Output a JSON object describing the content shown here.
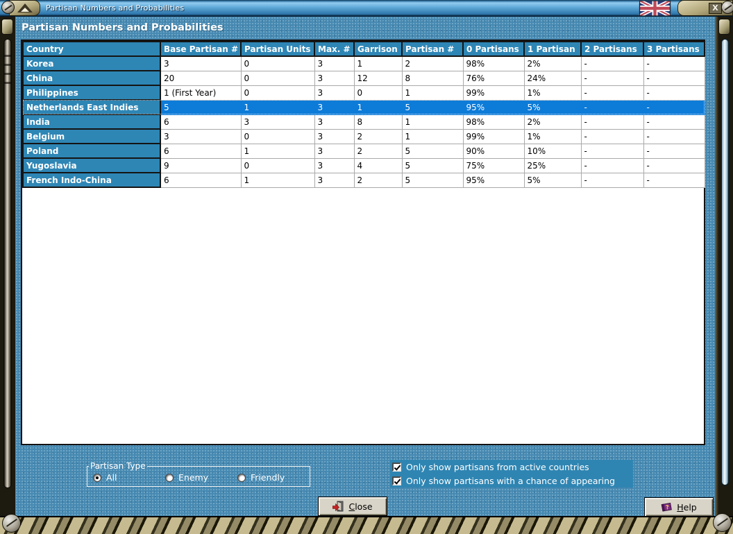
{
  "window": {
    "title": "Partisan Numbers and Probabilities",
    "heading": "Partisan Numbers and Probabilities",
    "close_glyph": "X"
  },
  "table": {
    "columns": [
      "Country",
      "Base Partisan #",
      "Partisan Units",
      "Max. #",
      "Garrison",
      "Partisan #",
      "0 Partisans",
      "1 Partisan",
      "2 Partisans",
      "3 Partisans"
    ],
    "rows": [
      {
        "country": "Korea",
        "values": [
          "3",
          "0",
          "3",
          "1",
          "2",
          "98%",
          "2%",
          "-",
          "-"
        ],
        "selected": false
      },
      {
        "country": "China",
        "values": [
          "20",
          "0",
          "3",
          "12",
          "8",
          "76%",
          "24%",
          "-",
          "-"
        ],
        "selected": false
      },
      {
        "country": "Philippines",
        "values": [
          "1 (First Year)",
          "0",
          "3",
          "0",
          "1",
          "99%",
          "1%",
          "-",
          "-"
        ],
        "selected": false
      },
      {
        "country": "Netherlands East Indies",
        "values": [
          "5",
          "1",
          "3",
          "1",
          "5",
          "95%",
          "5%",
          "-",
          "-"
        ],
        "selected": true
      },
      {
        "country": "India",
        "values": [
          "6",
          "3",
          "3",
          "8",
          "1",
          "98%",
          "2%",
          "-",
          "-"
        ],
        "selected": false
      },
      {
        "country": "Belgium",
        "values": [
          "3",
          "0",
          "3",
          "2",
          "1",
          "99%",
          "1%",
          "-",
          "-"
        ],
        "selected": false
      },
      {
        "country": "Poland",
        "values": [
          "6",
          "1",
          "3",
          "2",
          "5",
          "90%",
          "10%",
          "-",
          "-"
        ],
        "selected": false
      },
      {
        "country": "Yugoslavia",
        "values": [
          "9",
          "0",
          "3",
          "4",
          "5",
          "75%",
          "25%",
          "-",
          "-"
        ],
        "selected": false
      },
      {
        "country": "French Indo-China",
        "values": [
          "6",
          "1",
          "3",
          "2",
          "5",
          "95%",
          "5%",
          "-",
          "-"
        ],
        "selected": false
      }
    ]
  },
  "partisan_type": {
    "legend": "Partisan Type",
    "options": [
      {
        "label": "All",
        "selected": true
      },
      {
        "label": "Enemy",
        "selected": false
      },
      {
        "label": "Friendly",
        "selected": false
      }
    ]
  },
  "filters": [
    {
      "label": "Only show partisans from active countries",
      "checked": true
    },
    {
      "label": "Only show partisans with a chance of appearing",
      "checked": true
    }
  ],
  "buttons": {
    "close": "Close",
    "help": "Help"
  },
  "colors": {
    "header_teal": "#2e86b5",
    "selection_blue": "#0d7bd8",
    "content_background": "#4689b2",
    "frame_tan": "#b0a578",
    "filter_strip": "#2f85b2",
    "button_face": "#d8d4c8"
  }
}
